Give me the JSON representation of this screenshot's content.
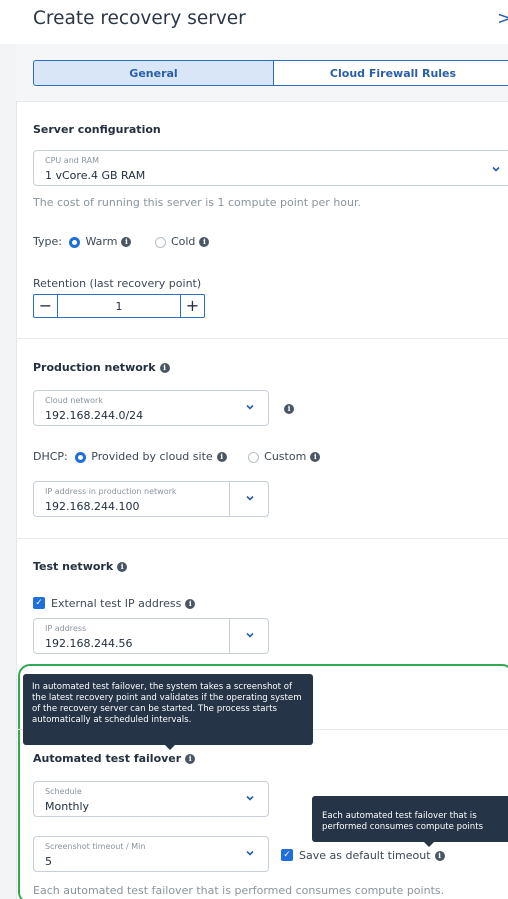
{
  "header": {
    "title": "Create recovery server",
    "close_glyph": ">"
  },
  "tabs": [
    {
      "label": "General",
      "active": true
    },
    {
      "label": "Cloud Firewall Rules",
      "active": false
    }
  ],
  "server_config": {
    "heading": "Server configuration",
    "cpu_ram": {
      "label": "CPU and RAM",
      "value": "1 vCore.4 GB RAM"
    },
    "cost_note": "The cost of running this server is 1 compute point per hour.",
    "type_label": "Type:",
    "type_options": [
      {
        "label": "Warm",
        "selected": true
      },
      {
        "label": "Cold",
        "selected": false
      }
    ],
    "retention_label": "Retention (last recovery point)",
    "retention_value": "1",
    "minus": "−",
    "plus": "+"
  },
  "production_network": {
    "heading": "Production network",
    "cloud_network": {
      "label": "Cloud network",
      "value": "192.168.244.0/24"
    },
    "dhcp_label": "DHCP:",
    "dhcp_options": [
      {
        "label": "Provided by cloud site",
        "selected": true
      },
      {
        "label": "Custom",
        "selected": false
      }
    ],
    "ip_field": {
      "label": "IP address in production network",
      "value": "192.168.244.100"
    }
  },
  "test_network": {
    "heading": "Test network",
    "external_ip_label": "External test IP address",
    "external_ip_checked": true,
    "ip_field": {
      "label": "IP address",
      "value": "192.168.244.56"
    }
  },
  "tooltip_main": "In automated test failover, the system takes a screenshot of the latest recovery point and validates if the operating system of the recovery server can be started. The process starts automatically at scheduled intervals.",
  "automated_failover": {
    "heading": "Automated test failover",
    "schedule": {
      "label": "Schedule",
      "value": "Monthly"
    },
    "timeout": {
      "label": "Screenshot timeout / Min",
      "value": "5"
    },
    "save_default_label": "Save as default timeout",
    "save_default_checked": true,
    "tooltip_cost": "Each automated test failover that is performed consumes compute points",
    "footer_note": "Each automated test failover that is performed consumes compute points."
  },
  "info_glyph": "i",
  "check_glyph": "✓",
  "colors": {
    "accent": "#1e6fd9",
    "tooltip_bg": "#253446",
    "highlight_frame": "#35a853"
  }
}
